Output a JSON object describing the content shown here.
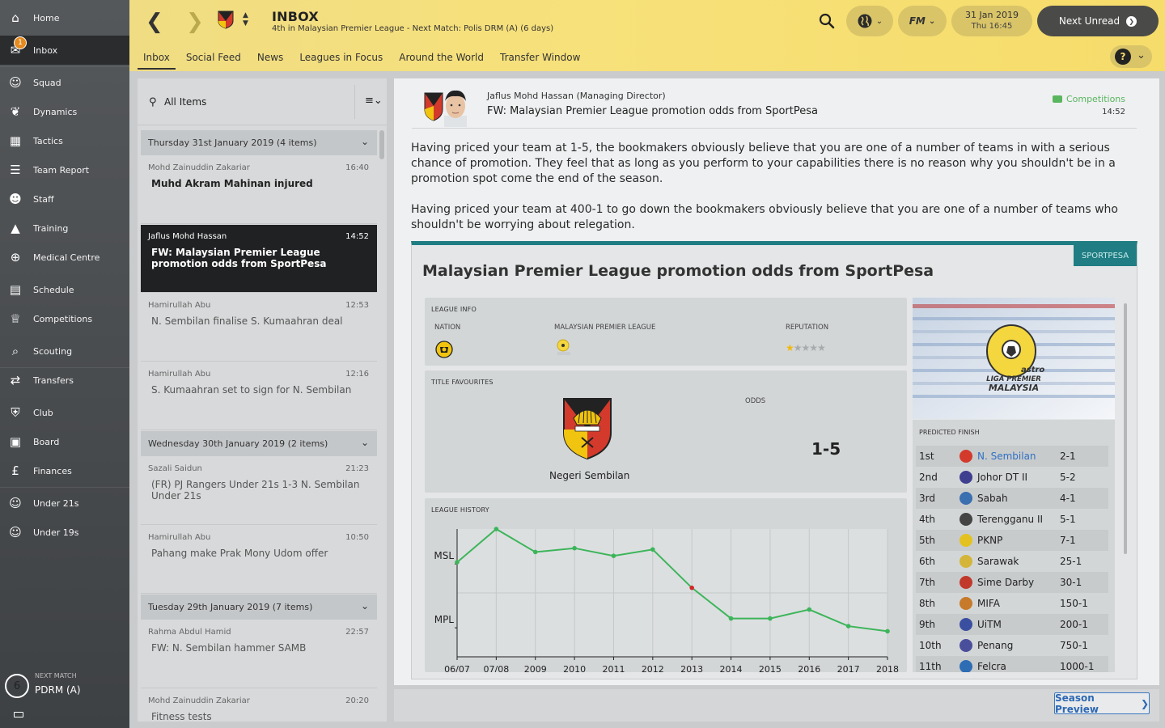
{
  "sidebar": {
    "items": [
      {
        "label": "Home",
        "icon": "home-icon"
      },
      {
        "label": "Inbox",
        "icon": "inbox-icon",
        "badge": "1"
      },
      {
        "label": "Squad",
        "icon": "squad-icon"
      },
      {
        "label": "Dynamics",
        "icon": "dynamics-icon"
      },
      {
        "label": "Tactics",
        "icon": "tactics-icon"
      },
      {
        "label": "Team Report",
        "icon": "report-icon"
      },
      {
        "label": "Staff",
        "icon": "staff-icon"
      },
      {
        "label": "Training",
        "icon": "training-icon"
      },
      {
        "label": "Medical Centre",
        "icon": "medical-icon"
      },
      {
        "label": "Schedule",
        "icon": "calendar-icon"
      },
      {
        "label": "Competitions",
        "icon": "trophy-icon"
      },
      {
        "label": "Scouting",
        "icon": "search-icon"
      },
      {
        "label": "Transfers",
        "icon": "transfers-icon"
      },
      {
        "label": "Club",
        "icon": "shield-icon"
      },
      {
        "label": "Board",
        "icon": "board-icon"
      },
      {
        "label": "Finances",
        "icon": "pound-icon"
      },
      {
        "label": "Under 21s",
        "icon": "u21-icon"
      },
      {
        "label": "Under 19s",
        "icon": "u19-icon"
      }
    ],
    "next_match": {
      "label": "NEXT MATCH",
      "value": "PDRM (A)",
      "days": "6"
    }
  },
  "topbar": {
    "title": "INBOX",
    "subtitle": "4th in Malaysian Premier League - Next Match: Polis DRM (A) (6 days)",
    "date": "31 Jan 2019",
    "time": "Thu 16:45",
    "next_unread": "Next Unread",
    "fm_label": "FM",
    "help": "?"
  },
  "tabs": [
    "Inbox",
    "Social Feed",
    "News",
    "Leagues in Focus",
    "Around the World",
    "Transfer Window"
  ],
  "list": {
    "filter": "All Items",
    "groups": [
      {
        "title": "Thursday 31st January 2019 (4 items)"
      },
      {
        "title": "Wednesday 30th January 2019 (2 items)"
      },
      {
        "title": "Tuesday 29th January 2019 (7 items)"
      }
    ],
    "messages": [
      {
        "from": "Mohd Zainuddin Zakariar",
        "time": "16:40",
        "subject": "Muhd Akram Mahinan injured"
      },
      {
        "from": "Jaflus Mohd Hassan",
        "time": "14:52",
        "subject": "FW: Malaysian Premier League promotion odds from SportPesa"
      },
      {
        "from": "Hamirullah Abu",
        "time": "12:53",
        "subject": "N. Sembilan finalise S. Kumaahran deal"
      },
      {
        "from": "Hamirullah Abu",
        "time": "12:16",
        "subject": "S. Kumaahran set to sign for N. Sembilan"
      },
      {
        "from": "Sazali Saidun",
        "time": "21:23",
        "subject": "(FR) PJ Rangers Under 21s 1-3 N. Sembilan Under 21s"
      },
      {
        "from": "Hamirullah Abu",
        "time": "10:50",
        "subject": "Pahang make Prak Mony Udom offer"
      },
      {
        "from": "Rahma Abdul Hamid",
        "time": "22:57",
        "subject": "FW: N. Sembilan hammer SAMB"
      },
      {
        "from": "Mohd Zainuddin Zakariar",
        "time": "20:20",
        "subject": "Fitness tests"
      }
    ]
  },
  "message": {
    "from": "Jaflus Mohd Hassan",
    "role": "(Managing Director)",
    "subject": "FW: Malaysian Premier League promotion odds from SportPesa",
    "category": "Competitions",
    "time": "14:52",
    "paragraphs": [
      "Having priced your team at 1-5, the bookmakers obviously believe that you are one of a number of teams in with a serious chance of promotion. They feel that as long as you perform to your capabilities there is no reason why you shouldn't be in a promotion spot come the end of the season.",
      "Having priced your team at 400-1 to go down the bookmakers obviously believe that you are one of a number of teams who shouldn't be worrying about relegation."
    ],
    "card": {
      "title": "Malaysian Premier League promotion odds from SportPesa",
      "source": "SPORTPESA",
      "league_info": {
        "header": "LEAGUE INFO",
        "nation_label": "NATION",
        "league_label": "MALAYSIAN PREMIER LEAGUE",
        "reputation_label": "REPUTATION",
        "reputation_stars": 1,
        "reputation_max": 5
      },
      "favourites": {
        "header": "TITLE FAVOURITES",
        "team": "Negeri Sembilan",
        "odds_label": "ODDS",
        "odds": "1-5"
      },
      "banner": {
        "brand": "astro",
        "line1": "LIGA PREMIER",
        "line2": "MALAYSIA"
      },
      "predicted": {
        "header": "PREDICTED FINISH",
        "rows": [
          {
            "pos": "1st",
            "team": "N. Sembilan",
            "odds": "2-1",
            "color": "#d33a2c"
          },
          {
            "pos": "2nd",
            "team": "Johor DT II",
            "odds": "5-2",
            "color": "#3e3f8f"
          },
          {
            "pos": "3rd",
            "team": "Sabah",
            "odds": "4-1",
            "color": "#3a6fb0"
          },
          {
            "pos": "4th",
            "team": "Terengganu II",
            "odds": "5-1",
            "color": "#444444"
          },
          {
            "pos": "5th",
            "team": "PKNP",
            "odds": "7-1",
            "color": "#e3c21f"
          },
          {
            "pos": "6th",
            "team": "Sarawak",
            "odds": "25-1",
            "color": "#d4b53a"
          },
          {
            "pos": "7th",
            "team": "Sime Darby",
            "odds": "30-1",
            "color": "#c0392b"
          },
          {
            "pos": "8th",
            "team": "MIFA",
            "odds": "150-1",
            "color": "#c77a2a"
          },
          {
            "pos": "9th",
            "team": "UiTM",
            "odds": "200-1",
            "color": "#3b4fa0"
          },
          {
            "pos": "10th",
            "team": "Penang",
            "odds": "750-1",
            "color": "#4a4f9c"
          },
          {
            "pos": "11th",
            "team": "Felcra",
            "odds": "1000-1",
            "color": "#2e6db4"
          }
        ]
      }
    }
  },
  "footer": {
    "season_preview": "Season Preview"
  },
  "colors": {
    "accent": "#f6dc6a",
    "sidebar": "#45484b",
    "teal": "#1f7d83",
    "highlight_point": "#d62728",
    "line": "#3cb55a"
  },
  "chart_data": {
    "type": "line",
    "header": "LEAGUE HISTORY",
    "categories": [
      "06/07",
      "07/08",
      "2009",
      "2010",
      "2011",
      "2012",
      "2013",
      "2014",
      "2015",
      "2016",
      "2017",
      "2018"
    ],
    "y_categories": [
      "MSL",
      "MPL"
    ],
    "series": [
      {
        "values": [
          0.74,
          1.0,
          0.82,
          0.85,
          0.79,
          0.84,
          0.54,
          0.3,
          0.3,
          0.37,
          0.24,
          0.2
        ]
      }
    ],
    "highlight_index": 6,
    "ylim": [
      0,
      1
    ]
  }
}
